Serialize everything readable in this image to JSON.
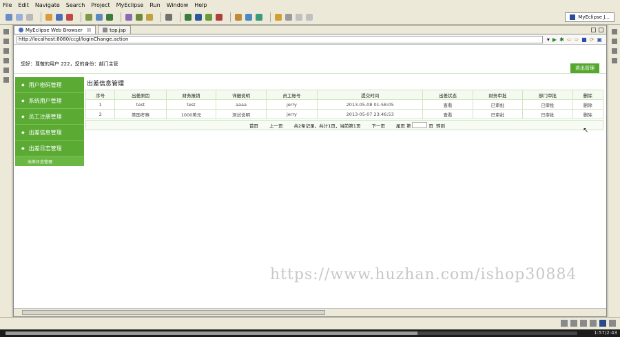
{
  "menu": [
    "File",
    "Edit",
    "Navigate",
    "Search",
    "Project",
    "MyEclipse",
    "Run",
    "Window",
    "Help"
  ],
  "perspective": {
    "label": "MyEclipse J..."
  },
  "tabs": [
    {
      "label": "MyEclipse Web Browser",
      "close": "☒"
    },
    {
      "label": "top.jsp",
      "close": ""
    }
  ],
  "browser": {
    "url": "http://localhost:8080/ccgl/loginChange.action"
  },
  "header": {
    "greeting": "您好：尊敬的用户 222，您的身份：部门主管",
    "logout": "退出管理"
  },
  "sidebar": {
    "items": [
      {
        "label": "用户密码管理"
      },
      {
        "label": "系统用户管理"
      },
      {
        "label": "员工注册管理"
      },
      {
        "label": "出差信息管理"
      },
      {
        "label": "出差日志管理"
      }
    ],
    "sub_label": "出差日志管理"
  },
  "content": {
    "title": "出差信息管理",
    "columns": [
      "序号",
      "出差原因",
      "财务报销",
      "详细说明",
      "员工帐号",
      "提交时间",
      "出差状态",
      "财务审批",
      "部门审批",
      "删除"
    ],
    "rows": [
      [
        "1",
        "test",
        "test",
        "aaaa",
        "jerry",
        "2013-05-08 01:58:05",
        "查看",
        "已审批",
        "已审批",
        "删除"
      ],
      [
        "2",
        "美国考察",
        "1000美元",
        "测试说明",
        "jerry",
        "2013-05-07 23:46:53",
        "查看",
        "已审批",
        "已审批",
        "删除"
      ]
    ]
  },
  "pager": {
    "first": "首页",
    "prev": "上一页",
    "info": "共2条记录，共计1页，当前第1页",
    "next": "下一页",
    "last": "尾页",
    "page_prefix": "第",
    "page_suffix": "页",
    "go": "转到"
  },
  "watermark": "https://www.huzhan.com/ishop30884",
  "player": {
    "time": "1:57/2:43",
    "progress": 0.72
  }
}
